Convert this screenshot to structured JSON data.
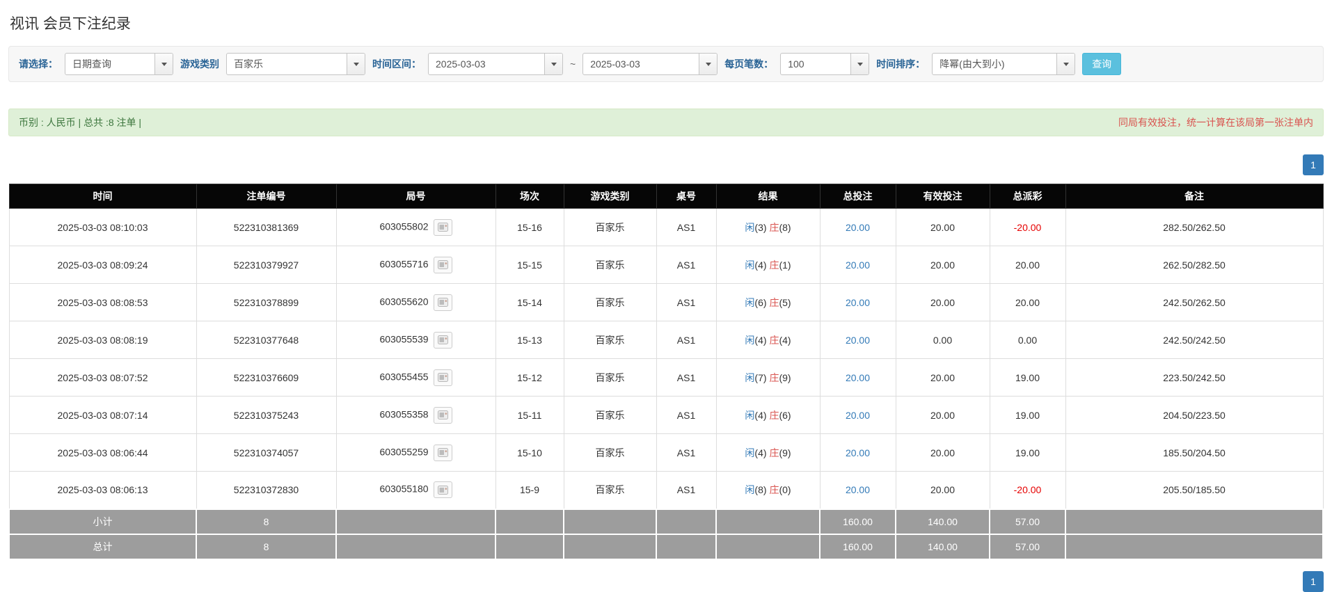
{
  "page_title": "视讯 会员下注纪录",
  "filters": {
    "select_label": "请选择：",
    "select_value": "日期查询",
    "game_type_label": "游戏类别",
    "game_type_value": "百家乐",
    "date_range_label": "时间区间：",
    "date_from": "2025-03-03",
    "date_separator": "~",
    "date_to": "2025-03-03",
    "page_size_label": "每页笔数：",
    "page_size_value": "100",
    "sort_label": "时间排序：",
    "sort_value": "降幂(由大到小)",
    "search_button": "查询"
  },
  "summary": {
    "left": "币别 : 人民币 | 总共 :8 注单 |",
    "right": "同局有效投注，统一计算在该局第一张注单内"
  },
  "pagination": {
    "page": "1"
  },
  "table": {
    "headers": [
      "时间",
      "注单编号",
      "局号",
      "场次",
      "游戏类别",
      "桌号",
      "结果",
      "总投注",
      "有效投注",
      "总派彩",
      "备注"
    ],
    "result_labels": {
      "player": "闲",
      "banker": "庄"
    },
    "rows": [
      {
        "time": "2025-03-03 08:10:03",
        "bet_id": "522310381369",
        "round_id": "603055802",
        "session": "15-16",
        "game": "百家乐",
        "table_no": "AS1",
        "player_score": "(3)",
        "banker_score": "(8)",
        "total_bet": "20.00",
        "valid_bet": "20.00",
        "payout": "-20.00",
        "remark": "282.50/262.50"
      },
      {
        "time": "2025-03-03 08:09:24",
        "bet_id": "522310379927",
        "round_id": "603055716",
        "session": "15-15",
        "game": "百家乐",
        "table_no": "AS1",
        "player_score": "(4)",
        "banker_score": "(1)",
        "total_bet": "20.00",
        "valid_bet": "20.00",
        "payout": "20.00",
        "remark": "262.50/282.50"
      },
      {
        "time": "2025-03-03 08:08:53",
        "bet_id": "522310378899",
        "round_id": "603055620",
        "session": "15-14",
        "game": "百家乐",
        "table_no": "AS1",
        "player_score": "(6)",
        "banker_score": "(5)",
        "total_bet": "20.00",
        "valid_bet": "20.00",
        "payout": "20.00",
        "remark": "242.50/262.50"
      },
      {
        "time": "2025-03-03 08:08:19",
        "bet_id": "522310377648",
        "round_id": "603055539",
        "session": "15-13",
        "game": "百家乐",
        "table_no": "AS1",
        "player_score": "(4)",
        "banker_score": "(4)",
        "total_bet": "20.00",
        "valid_bet": "0.00",
        "payout": "0.00",
        "remark": "242.50/242.50"
      },
      {
        "time": "2025-03-03 08:07:52",
        "bet_id": "522310376609",
        "round_id": "603055455",
        "session": "15-12",
        "game": "百家乐",
        "table_no": "AS1",
        "player_score": "(7)",
        "banker_score": "(9)",
        "total_bet": "20.00",
        "valid_bet": "20.00",
        "payout": "19.00",
        "remark": "223.50/242.50"
      },
      {
        "time": "2025-03-03 08:07:14",
        "bet_id": "522310375243",
        "round_id": "603055358",
        "session": "15-11",
        "game": "百家乐",
        "table_no": "AS1",
        "player_score": "(4)",
        "banker_score": "(6)",
        "total_bet": "20.00",
        "valid_bet": "20.00",
        "payout": "19.00",
        "remark": "204.50/223.50"
      },
      {
        "time": "2025-03-03 08:06:44",
        "bet_id": "522310374057",
        "round_id": "603055259",
        "session": "15-10",
        "game": "百家乐",
        "table_no": "AS1",
        "player_score": "(4)",
        "banker_score": "(9)",
        "total_bet": "20.00",
        "valid_bet": "20.00",
        "payout": "19.00",
        "remark": "185.50/204.50"
      },
      {
        "time": "2025-03-03 08:06:13",
        "bet_id": "522310372830",
        "round_id": "603055180",
        "session": "15-9",
        "game": "百家乐",
        "table_no": "AS1",
        "player_score": "(8)",
        "banker_score": "(0)",
        "total_bet": "20.00",
        "valid_bet": "20.00",
        "payout": "-20.00",
        "remark": "205.50/185.50"
      }
    ],
    "subtotal_row": [
      "小计",
      "8",
      "",
      "",
      "",
      "",
      "",
      "160.00",
      "140.00",
      "57.00",
      ""
    ],
    "total_row": [
      "总计",
      "8",
      "",
      "",
      "",
      "",
      "",
      "160.00",
      "140.00",
      "57.00",
      ""
    ]
  },
  "colors": {
    "header_bg": "#060606",
    "footer_bg": "#9d9d9d",
    "player_blue": "#337ab7",
    "banker_red": "#d9534f",
    "link_blue": "#337ab7",
    "negative_red": "#e60000",
    "notice_red": "#d9534f",
    "summary_bg": "#dff0d8",
    "search_button_bg": "#5bc0de",
    "pagination_bg": "#337ab7"
  }
}
